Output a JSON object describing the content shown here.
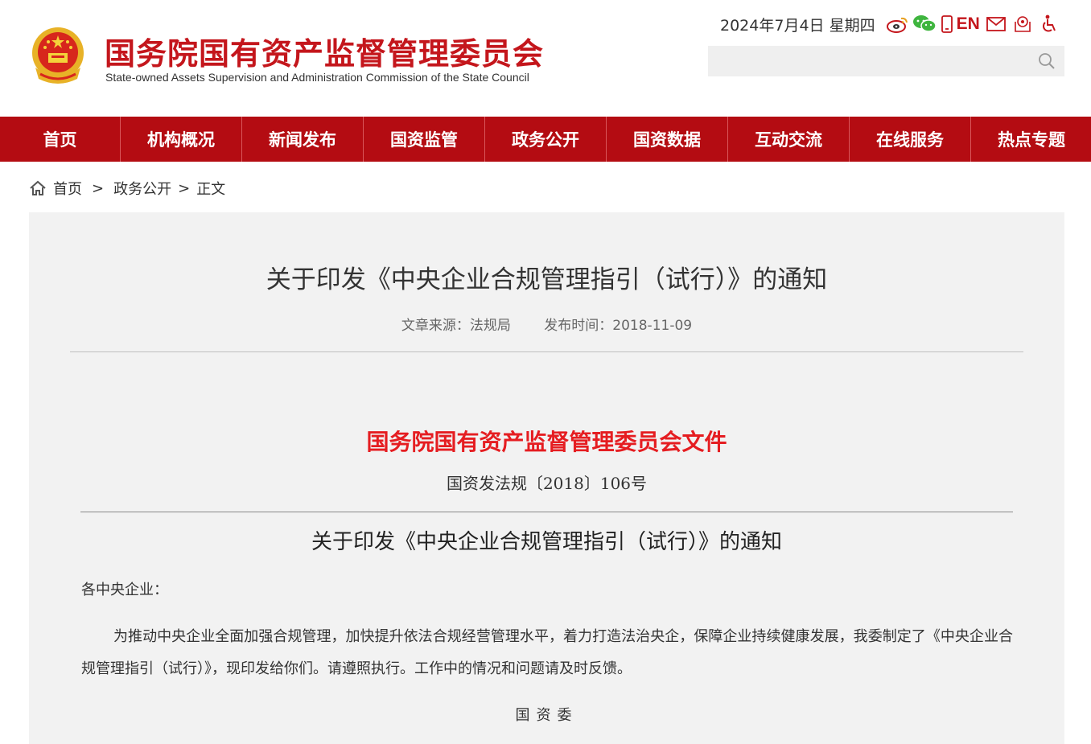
{
  "header": {
    "site_title": "国务院国有资产监督管理委员会",
    "site_subtitle": "State-owned Assets Supervision and Administration Commission of the State Council",
    "date": "2024年7月4日 星期四",
    "en_label": "EN",
    "icons": [
      "weibo-icon",
      "wechat-icon",
      "mobile-icon",
      "mail-icon",
      "map-pin-icon",
      "accessibility-icon"
    ],
    "search_placeholder": "",
    "brand_color": "#c4161c"
  },
  "nav": {
    "items": [
      {
        "label": "首页"
      },
      {
        "label": "机构概况"
      },
      {
        "label": "新闻发布"
      },
      {
        "label": "国资监管"
      },
      {
        "label": "政务公开"
      },
      {
        "label": "国资数据"
      },
      {
        "label": "互动交流"
      },
      {
        "label": "在线服务"
      },
      {
        "label": "热点专题"
      }
    ],
    "bg_color": "#b40c12"
  },
  "breadcrumb": {
    "home": "首页",
    "sep": ">",
    "section": "政务公开",
    "current": "正文"
  },
  "article": {
    "title": "关于印发《中央企业合规管理指引（试行）》的通知",
    "source": "文章来源：法规局",
    "published": "发布时间：2018-11-09",
    "doc_header": "国务院国有资产监督管理委员会文件",
    "doc_number": "国资发法规〔2018〕106号",
    "doc_title": "关于印发《中央企业合规管理指引（试行）》的通知",
    "salutation": "各中央企业：",
    "body": "为推动中央企业全面加强合规管理，加快提升依法合规经营管理水平，着力打造法治央企，保障企业持续健康发展，我委制定了《中央企业合规管理指引（试行）》，现印发给你们。请遵照执行。工作中的情况和问题请及时反馈。",
    "signature": "国资委"
  }
}
